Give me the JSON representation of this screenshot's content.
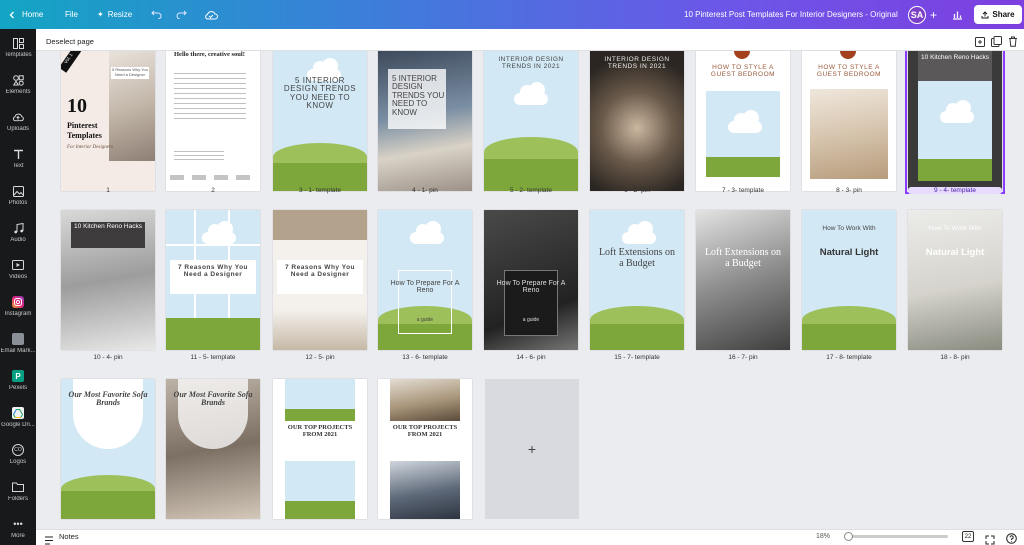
{
  "topbar": {
    "home": "Home",
    "file": "File",
    "resize": "Resize",
    "title": "10 Pinterest Post Templates For Interior Designers - Original",
    "avatar": "SA",
    "share": "Share"
  },
  "sidebar": {
    "items": [
      {
        "label": "Templates",
        "icon": "templates-icon"
      },
      {
        "label": "Elements",
        "icon": "elements-icon"
      },
      {
        "label": "Uploads",
        "icon": "uploads-icon"
      },
      {
        "label": "Text",
        "icon": "text-icon"
      },
      {
        "label": "Photos",
        "icon": "photos-icon"
      },
      {
        "label": "Audio",
        "icon": "audio-icon"
      },
      {
        "label": "Videos",
        "icon": "videos-icon"
      },
      {
        "label": "Instagram",
        "icon": "instagram-icon"
      },
      {
        "label": "Email Mark...",
        "icon": "email-marketing-icon"
      },
      {
        "label": "Pexels",
        "icon": "pexels-icon"
      },
      {
        "label": "Google Dri...",
        "icon": "google-drive-icon"
      },
      {
        "label": "Logos",
        "icon": "logos-icon"
      },
      {
        "label": "Folders",
        "icon": "folders-icon"
      },
      {
        "label": "More",
        "icon": "more-icon"
      }
    ]
  },
  "toolbar": {
    "deselect": "Deselect page"
  },
  "pages": {
    "captions": [
      "1",
      "2",
      "3 - 1- template",
      "4 - 1- pin",
      "5 - 2- template",
      "6 - 2- pin",
      "7 - 3- template",
      "8 - 3- pin",
      "9 - 4- template",
      "10 - 4- pin",
      "11 - 5- template",
      "12 - 5- pin",
      "13 - 6- template",
      "14 - 6- pin",
      "15 - 7- template",
      "16 - 7- pin",
      "17 - 8- template",
      "18 - 8- pin"
    ],
    "texts": {
      "p1_badge": "Vol. 1",
      "p1_number": "10",
      "p1_title": "Pinterest Templates",
      "p1_script": "For Interior Designers",
      "p1_mini": "5 Reasons Why You Need a Designer",
      "p2_title": "Hello there, creative soul!",
      "p3": "5 INTERIOR DESIGN TRENDS YOU NEED TO KNOW",
      "p4": "5 INTERIOR DESIGN TRENDS YOU NEED TO KNOW",
      "p5": "INTERIOR DESIGN TRENDS IN 2021",
      "p6": "INTERIOR DESIGN TRENDS IN 2021",
      "p7": "HOW TO STYLE A GUEST BEDROOM",
      "p8": "HOW TO STYLE A GUEST BEDROOM",
      "p9": "10 Kitchen Reno Hacks",
      "p10": "10 Kitchen Reno Hacks",
      "p11": "7 Reasons Why You Need a Designer",
      "p12": "7 Reasons Why You Need a Designer",
      "p13": "How To Prepare For A Reno",
      "p13_sub": "a guide",
      "p14": "How To Prepare For A Reno",
      "p14_sub": "a guide",
      "p15": "Loft Extensions on a Budget",
      "p16": "Loft Extensions on a Budget",
      "p17_top": "How To Work With",
      "p17_big": "Natural Light",
      "p18_top": "How To Work With",
      "p18_big": "Natural Light",
      "p19": "Our Most Favorite Sofa Brands",
      "p20": "Our Most Favorite Sofa Brands",
      "p21": "OUR TOP PROJECTS FROM 2021",
      "p22": "OUR TOP PROJECTS FROM 2021"
    },
    "add_page": "+"
  },
  "bottom": {
    "notes": "Notes",
    "zoom": "18%",
    "page_count": "22"
  },
  "colors": {
    "selected": "#8b3dff",
    "grass": "#7da63b",
    "sky": "#d2e8f5"
  }
}
